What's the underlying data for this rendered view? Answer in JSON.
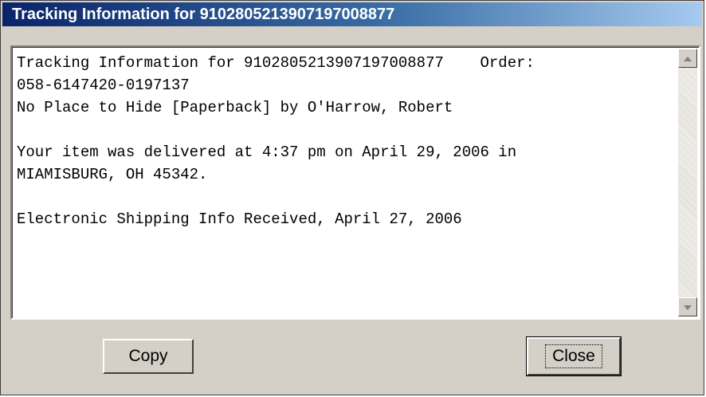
{
  "window": {
    "title": "Tracking Information for 9102805213907197008877"
  },
  "tracking_text": {
    "lines": [
      "Tracking Information for 9102805213907197008877    Order:",
      "058-6147420-0197137",
      "No Place to Hide [Paperback] by O'Harrow, Robert",
      "",
      "Your item was delivered at 4:37 pm on April 29, 2006 in",
      "MIAMISBURG, OH 45342.",
      "",
      "Electronic Shipping Info Received, April 27, 2006"
    ]
  },
  "buttons": {
    "copy_label": "Copy",
    "close_label": "Close"
  },
  "icons": {
    "scroll_up": "scroll-up-arrow",
    "scroll_down": "scroll-down-arrow"
  },
  "colors": {
    "title_bar_start": "#0a246a",
    "title_bar_end": "#a6caf0",
    "dialog_face": "#d4d0c8"
  }
}
